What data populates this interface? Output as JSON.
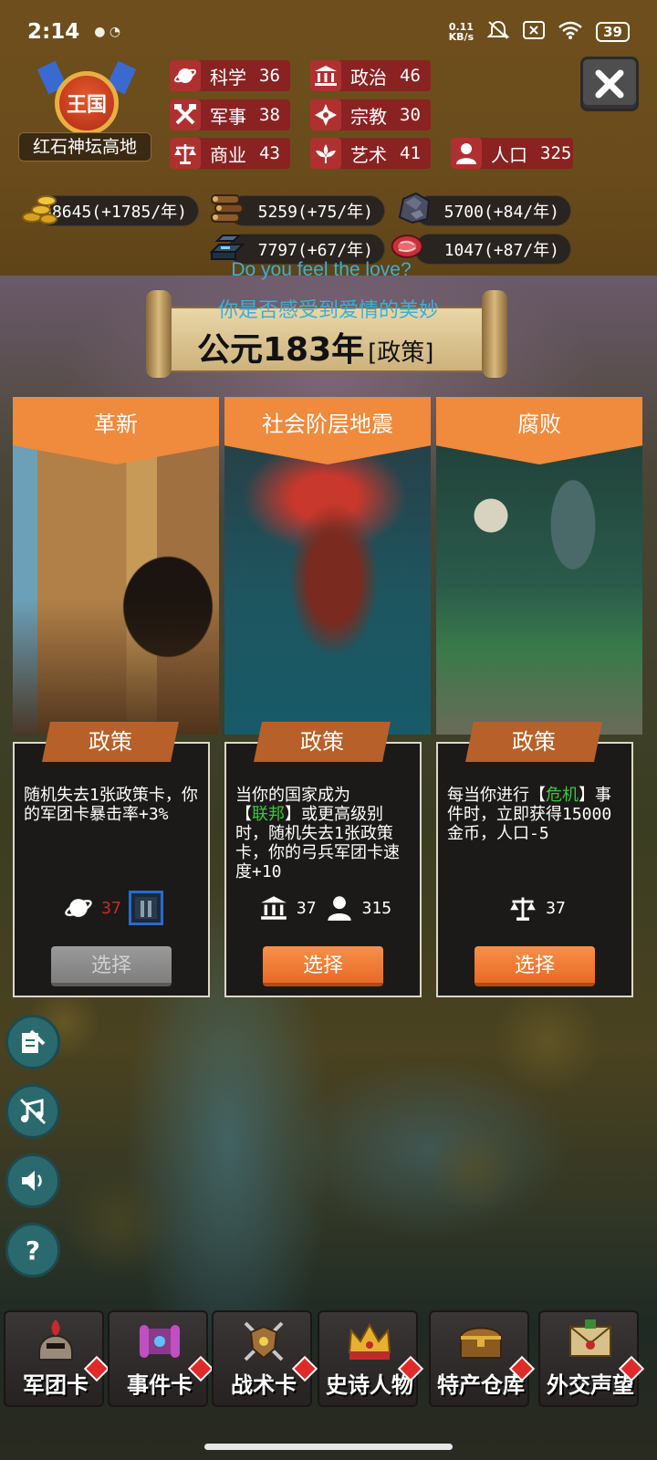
{
  "status_bar": {
    "time": "2:14",
    "net_speed_value": "0.11",
    "net_speed_unit": "KB/s",
    "battery": "39"
  },
  "kingdom": {
    "rank": "王国",
    "name": "红石神坛高地"
  },
  "stats": [
    {
      "label": "科学",
      "value": "36",
      "icon": "planet-icon"
    },
    {
      "label": "政治",
      "value": "46",
      "icon": "government-building-icon"
    },
    {
      "label": "军事",
      "value": "38",
      "icon": "crossed-tools-icon"
    },
    {
      "label": "宗教",
      "value": "30",
      "icon": "religion-cross-icon"
    },
    {
      "label": "商业",
      "value": "43",
      "icon": "scales-icon"
    },
    {
      "label": "艺术",
      "value": "41",
      "icon": "art-flower-icon"
    },
    {
      "label": "人口",
      "value": "325",
      "icon": "person-icon"
    }
  ],
  "resources": [
    {
      "name": "gold-coins-icon",
      "text": "58645(+1785/年)"
    },
    {
      "name": "wood-logs-icon",
      "text": "5259(+75/年)"
    },
    {
      "name": "stone-ore-icon",
      "text": "5700(+84/年)"
    },
    {
      "name": "iron-ingot-icon",
      "text": "7797(+67/年)"
    },
    {
      "name": "meat-icon",
      "text": "1047(+87/年)"
    }
  ],
  "lyrics": {
    "english": "Do you feel the love?",
    "chinese": "你是否感受到爱情的美妙"
  },
  "year_banner": {
    "year": "公元183年",
    "tag": "[政策]"
  },
  "cards": [
    {
      "title": "革新",
      "type": "政策",
      "desc": "随机失去1张政策卡，你的军团卡暴击率+3%",
      "requirements": [
        {
          "icon": "planet-icon",
          "value": "37",
          "met": false
        }
      ],
      "has_thumbnail": true,
      "button": "选择",
      "enabled": false
    },
    {
      "title": "社会阶层地震",
      "type": "政策",
      "desc_prefix": "当你的国家成为\n【",
      "desc_highlight": "联邦",
      "desc_suffix": "】或更高级别时，随机失去1张政策卡，你的弓兵军团卡速度+10",
      "requirements": [
        {
          "icon": "government-building-icon",
          "value": "37",
          "met": true
        },
        {
          "icon": "person-icon",
          "value": "315",
          "met": true
        }
      ],
      "button": "选择",
      "enabled": true
    },
    {
      "title": "腐败",
      "type": "政策",
      "desc_prefix": "每当你进行【",
      "desc_highlight": "危机",
      "desc_suffix": "】事件时，立即获得15000金币，人口-5",
      "requirements": [
        {
          "icon": "scales-icon",
          "value": "37",
          "met": true
        }
      ],
      "button": "选择",
      "enabled": true
    }
  ],
  "side_buttons": [
    {
      "name": "quest-log-icon"
    },
    {
      "name": "music-muted-icon"
    },
    {
      "name": "sound-icon"
    },
    {
      "name": "help-icon",
      "glyph": "?"
    }
  ],
  "tabs": [
    {
      "label": "军团卡",
      "icon": "helmet-icon"
    },
    {
      "label": "事件卡",
      "icon": "scroll-icon"
    },
    {
      "label": "战术卡",
      "icon": "shield-swords-icon"
    },
    {
      "label": "史诗人物",
      "icon": "crown-icon"
    },
    {
      "label": "特产仓库",
      "icon": "treasure-chest-icon"
    },
    {
      "label": "外交声望",
      "icon": "envelope-icon"
    }
  ],
  "colors": {
    "header_bg": "#6a4c1c",
    "stat_chip": "#8a2222",
    "ribbon_orange": "#f08a3c",
    "button_orange": "#e86a26",
    "lyric_blue": "#3ab0d8",
    "highlight_green": "#3ac83a",
    "unmet_red": "#c82a2a"
  }
}
